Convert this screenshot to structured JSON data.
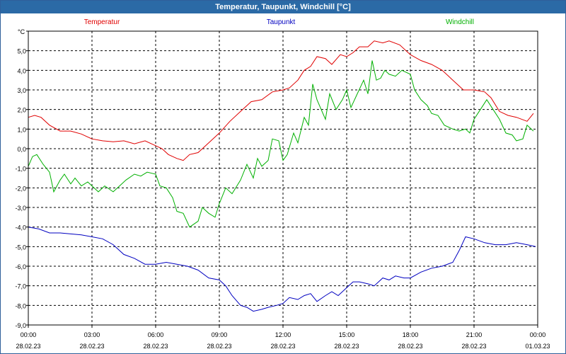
{
  "window": {
    "title": "Temperatur, Taupunkt, Windchill [°C]"
  },
  "chart_data": {
    "type": "line",
    "title": "Temperatur, Taupunkt, Windchill [°C]",
    "ylabel": "°C",
    "ylim": [
      -9,
      6
    ],
    "yticks": [
      6.0,
      5.0,
      4.0,
      3.0,
      2.0,
      1.0,
      0.0,
      -1.0,
      -2.0,
      -3.0,
      -4.0,
      -5.0,
      -6.0,
      -7.0,
      -8.0,
      -9.0
    ],
    "ytick_labels": [
      "",
      "5,0",
      "4,0",
      "3,0",
      "2,0",
      "1,0",
      "0,0",
      "-1,0",
      "-2,0",
      "-3,0",
      "-4,0",
      "-5,0",
      "-6,0",
      "-7,0",
      "-8,0",
      "-9,0"
    ],
    "xlim": [
      0,
      24
    ],
    "x_ticks": [
      {
        "time": "00:00",
        "date": "28.02.23"
      },
      {
        "time": "03:00",
        "date": "28.02.23"
      },
      {
        "time": "06:00",
        "date": "28.02.23"
      },
      {
        "time": "09:00",
        "date": "28.02.23"
      },
      {
        "time": "12:00",
        "date": "28.02.23"
      },
      {
        "time": "15:00",
        "date": "28.02.23"
      },
      {
        "time": "18:00",
        "date": "28.02.23"
      },
      {
        "time": "21:00",
        "date": "28.02.23"
      },
      {
        "time": "00:00",
        "date": "01.03.23"
      }
    ],
    "grid": true,
    "legend_placement": "top",
    "series": [
      {
        "name": "Temperatur",
        "color": "#e00000",
        "points": [
          [
            0,
            1.6
          ],
          [
            0.3,
            1.7
          ],
          [
            0.6,
            1.6
          ],
          [
            1,
            1.2
          ],
          [
            1.5,
            0.9
          ],
          [
            2,
            0.9
          ],
          [
            2.5,
            0.75
          ],
          [
            3,
            0.5
          ],
          [
            3.5,
            0.4
          ],
          [
            4,
            0.35
          ],
          [
            4.5,
            0.4
          ],
          [
            5,
            0.25
          ],
          [
            5.5,
            0.4
          ],
          [
            6,
            0.15
          ],
          [
            6.3,
            0
          ],
          [
            6.6,
            -0.3
          ],
          [
            7,
            -0.5
          ],
          [
            7.3,
            -0.6
          ],
          [
            7.6,
            -0.3
          ],
          [
            8,
            -0.2
          ],
          [
            8.5,
            0.3
          ],
          [
            9,
            0.8
          ],
          [
            9.5,
            1.4
          ],
          [
            10,
            1.9
          ],
          [
            10.5,
            2.4
          ],
          [
            11,
            2.5
          ],
          [
            11.5,
            2.9
          ],
          [
            12,
            3.0
          ],
          [
            12.3,
            3.1
          ],
          [
            12.7,
            3.5
          ],
          [
            13,
            4.0
          ],
          [
            13.3,
            4.2
          ],
          [
            13.6,
            4.7
          ],
          [
            14,
            4.6
          ],
          [
            14.3,
            4.3
          ],
          [
            14.7,
            4.8
          ],
          [
            15,
            4.7
          ],
          [
            15.3,
            4.9
          ],
          [
            15.6,
            5.2
          ],
          [
            16,
            5.2
          ],
          [
            16.3,
            5.5
          ],
          [
            16.7,
            5.4
          ],
          [
            17,
            5.5
          ],
          [
            17.5,
            5.3
          ],
          [
            18,
            4.8
          ],
          [
            18.5,
            4.5
          ],
          [
            19,
            4.3
          ],
          [
            19.5,
            4.0
          ],
          [
            20,
            3.5
          ],
          [
            20.5,
            3.0
          ],
          [
            21,
            3.0
          ],
          [
            21.5,
            2.9
          ],
          [
            21.8,
            2.6
          ],
          [
            22.2,
            1.9
          ],
          [
            22.6,
            1.7
          ],
          [
            23,
            1.6
          ],
          [
            23.5,
            1.4
          ],
          [
            23.8,
            1.8
          ]
        ]
      },
      {
        "name": "Taupunkt",
        "color": "#0000c0",
        "points": [
          [
            0,
            -4.0
          ],
          [
            0.5,
            -4.1
          ],
          [
            1,
            -4.3
          ],
          [
            1.5,
            -4.3
          ],
          [
            2,
            -4.35
          ],
          [
            2.5,
            -4.4
          ],
          [
            3,
            -4.5
          ],
          [
            3.5,
            -4.6
          ],
          [
            4,
            -4.9
          ],
          [
            4.5,
            -5.4
          ],
          [
            5,
            -5.6
          ],
          [
            5.5,
            -5.9
          ],
          [
            6,
            -5.9
          ],
          [
            6.5,
            -5.8
          ],
          [
            7,
            -5.9
          ],
          [
            7.5,
            -6.0
          ],
          [
            8,
            -6.2
          ],
          [
            8.5,
            -6.6
          ],
          [
            9,
            -6.7
          ],
          [
            9.3,
            -7.0
          ],
          [
            9.6,
            -7.5
          ],
          [
            10,
            -8.0
          ],
          [
            10.3,
            -8.1
          ],
          [
            10.6,
            -8.3
          ],
          [
            11,
            -8.2
          ],
          [
            11.3,
            -8.1
          ],
          [
            11.7,
            -8.0
          ],
          [
            12,
            -7.9
          ],
          [
            12.3,
            -7.6
          ],
          [
            12.7,
            -7.7
          ],
          [
            13,
            -7.5
          ],
          [
            13.3,
            -7.4
          ],
          [
            13.6,
            -7.8
          ],
          [
            14,
            -7.5
          ],
          [
            14.3,
            -7.3
          ],
          [
            14.6,
            -7.5
          ],
          [
            15,
            -7.1
          ],
          [
            15.3,
            -6.8
          ],
          [
            15.6,
            -6.8
          ],
          [
            16,
            -6.9
          ],
          [
            16.3,
            -7.0
          ],
          [
            16.7,
            -6.6
          ],
          [
            17,
            -6.7
          ],
          [
            17.3,
            -6.5
          ],
          [
            17.7,
            -6.6
          ],
          [
            18,
            -6.6
          ],
          [
            18.5,
            -6.3
          ],
          [
            19,
            -6.1
          ],
          [
            19.5,
            -6.0
          ],
          [
            20,
            -5.8
          ],
          [
            20.3,
            -5.2
          ],
          [
            20.6,
            -4.5
          ],
          [
            21,
            -4.6
          ],
          [
            21.5,
            -4.8
          ],
          [
            22,
            -4.9
          ],
          [
            22.5,
            -4.9
          ],
          [
            23,
            -4.8
          ],
          [
            23.5,
            -4.9
          ],
          [
            23.9,
            -5.0
          ]
        ]
      },
      {
        "name": "Windchill",
        "color": "#00b000",
        "points": [
          [
            0,
            -0.9
          ],
          [
            0.2,
            -0.4
          ],
          [
            0.4,
            -0.3
          ],
          [
            0.7,
            -0.8
          ],
          [
            1,
            -1.2
          ],
          [
            1.2,
            -2.2
          ],
          [
            1.5,
            -1.6
          ],
          [
            1.7,
            -1.3
          ],
          [
            2,
            -1.8
          ],
          [
            2.2,
            -1.5
          ],
          [
            2.5,
            -1.9
          ],
          [
            2.8,
            -1.7
          ],
          [
            3,
            -1.9
          ],
          [
            3.3,
            -2.2
          ],
          [
            3.6,
            -1.9
          ],
          [
            4,
            -2.2
          ],
          [
            4.3,
            -1.9
          ],
          [
            4.6,
            -1.6
          ],
          [
            5,
            -1.3
          ],
          [
            5.3,
            -1.4
          ],
          [
            5.6,
            -1.2
          ],
          [
            6,
            -1.3
          ],
          [
            6.2,
            -1.9
          ],
          [
            6.5,
            -2.0
          ],
          [
            6.8,
            -2.5
          ],
          [
            7,
            -3.2
          ],
          [
            7.3,
            -3.3
          ],
          [
            7.6,
            -4.0
          ],
          [
            8,
            -3.7
          ],
          [
            8.2,
            -3.0
          ],
          [
            8.5,
            -3.3
          ],
          [
            8.8,
            -3.5
          ],
          [
            9,
            -2.8
          ],
          [
            9.3,
            -2.0
          ],
          [
            9.6,
            -2.3
          ],
          [
            10,
            -1.6
          ],
          [
            10.3,
            -0.8
          ],
          [
            10.6,
            -1.5
          ],
          [
            10.8,
            -0.5
          ],
          [
            11,
            -0.9
          ],
          [
            11.3,
            -0.6
          ],
          [
            11.5,
            0.5
          ],
          [
            11.8,
            0.4
          ],
          [
            12,
            -0.6
          ],
          [
            12.2,
            -0.3
          ],
          [
            12.5,
            0.8
          ],
          [
            12.7,
            0.3
          ],
          [
            13,
            1.6
          ],
          [
            13.2,
            1.2
          ],
          [
            13.4,
            3.3
          ],
          [
            13.6,
            2.5
          ],
          [
            13.8,
            2.0
          ],
          [
            14,
            1.5
          ],
          [
            14.2,
            2.8
          ],
          [
            14.5,
            2.0
          ],
          [
            14.8,
            2.5
          ],
          [
            15,
            3.0
          ],
          [
            15.2,
            2.1
          ],
          [
            15.5,
            2.8
          ],
          [
            15.8,
            3.5
          ],
          [
            16,
            2.8
          ],
          [
            16.2,
            4.5
          ],
          [
            16.4,
            3.5
          ],
          [
            16.6,
            3.6
          ],
          [
            16.8,
            4.0
          ],
          [
            17,
            3.8
          ],
          [
            17.3,
            3.7
          ],
          [
            17.6,
            4.0
          ],
          [
            18,
            3.8
          ],
          [
            18.2,
            3.0
          ],
          [
            18.5,
            2.5
          ],
          [
            18.8,
            2.2
          ],
          [
            19,
            1.8
          ],
          [
            19.3,
            1.7
          ],
          [
            19.6,
            1.2
          ],
          [
            20,
            1.0
          ],
          [
            20.3,
            0.9
          ],
          [
            20.6,
            1.0
          ],
          [
            20.8,
            0.8
          ],
          [
            21,
            1.5
          ],
          [
            21.3,
            2.0
          ],
          [
            21.6,
            2.5
          ],
          [
            21.9,
            2.0
          ],
          [
            22.2,
            1.5
          ],
          [
            22.5,
            0.8
          ],
          [
            22.8,
            0.7
          ],
          [
            23,
            0.4
          ],
          [
            23.3,
            0.5
          ],
          [
            23.5,
            1.2
          ],
          [
            23.8,
            0.9
          ]
        ]
      }
    ]
  }
}
